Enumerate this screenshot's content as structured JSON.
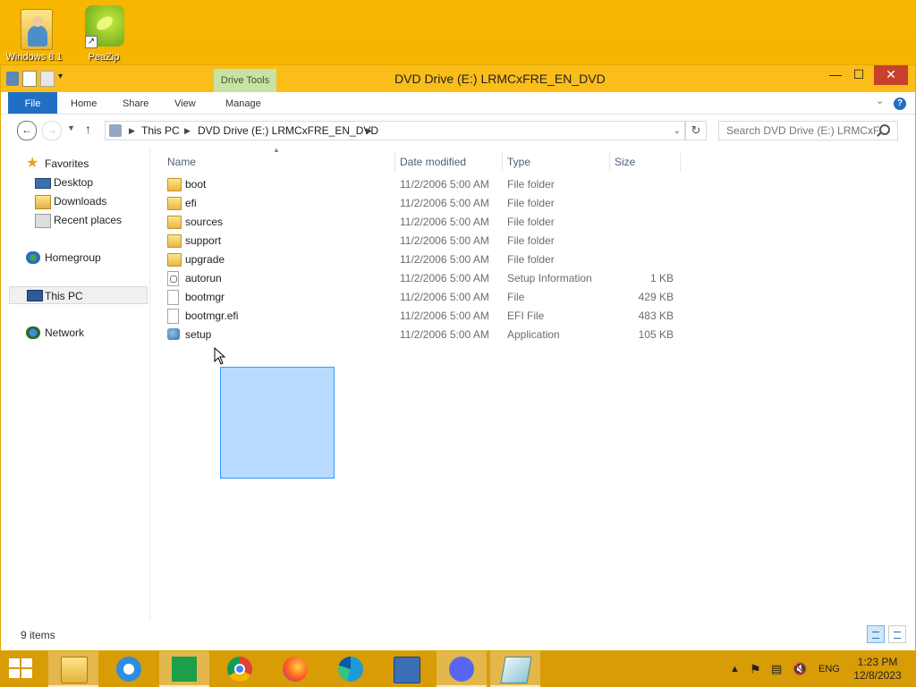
{
  "desktop": {
    "icons": [
      {
        "label": "Windows 8.1"
      },
      {
        "label": "PeaZip"
      }
    ]
  },
  "window": {
    "title": "DVD Drive (E:) LRMCxFRE_EN_DVD",
    "drive_tools": "Drive Tools",
    "buttons": {
      "minimize": "—",
      "maximize": "☐",
      "close": "✕"
    }
  },
  "ribbon": {
    "tabs": [
      "File",
      "Home",
      "Share",
      "View",
      "Manage"
    ],
    "help": "?"
  },
  "address": {
    "crumbs": [
      "This PC",
      "DVD Drive (E:) LRMCxFRE_EN_DVD"
    ],
    "search_placeholder": "Search DVD Drive (E:) LRMCxF..."
  },
  "navpane": {
    "favorites": "Favorites",
    "desktop": "Desktop",
    "downloads": "Downloads",
    "recent": "Recent places",
    "homegroup": "Homegroup",
    "thispc": "This PC",
    "network": "Network"
  },
  "columns": {
    "name": "Name",
    "date": "Date modified",
    "type": "Type",
    "size": "Size"
  },
  "files": [
    {
      "name": "boot",
      "date": "11/2/2006 5:00 AM",
      "type": "File folder",
      "size": "",
      "icon": "folder-icon"
    },
    {
      "name": "efi",
      "date": "11/2/2006 5:00 AM",
      "type": "File folder",
      "size": "",
      "icon": "folder-icon"
    },
    {
      "name": "sources",
      "date": "11/2/2006 5:00 AM",
      "type": "File folder",
      "size": "",
      "icon": "folder-icon"
    },
    {
      "name": "support",
      "date": "11/2/2006 5:00 AM",
      "type": "File folder",
      "size": "",
      "icon": "folder-icon"
    },
    {
      "name": "upgrade",
      "date": "11/2/2006 5:00 AM",
      "type": "File folder",
      "size": "",
      "icon": "folder-icon"
    },
    {
      "name": "autorun",
      "date": "11/2/2006 5:00 AM",
      "type": "Setup Information",
      "size": "1 KB",
      "icon": "setup-info-icon"
    },
    {
      "name": "bootmgr",
      "date": "11/2/2006 5:00 AM",
      "type": "File",
      "size": "429 KB",
      "icon": "file-icon"
    },
    {
      "name": "bootmgr.efi",
      "date": "11/2/2006 5:00 AM",
      "type": "EFI File",
      "size": "483 KB",
      "icon": "file-icon"
    },
    {
      "name": "setup",
      "date": "11/2/2006 5:00 AM",
      "type": "Application",
      "size": "105 KB",
      "icon": "application-icon"
    }
  ],
  "status": {
    "items": "9 items"
  },
  "taskbar": {
    "lang": "ENG",
    "time": "1:23 PM",
    "date": "12/8/2023"
  },
  "colors": {
    "desktop": "#f8b600",
    "titlebar": "#fbbd1a",
    "accent": "#1f6fc5",
    "close": "#c7402b",
    "drive_tools": "#c6e3a5"
  }
}
